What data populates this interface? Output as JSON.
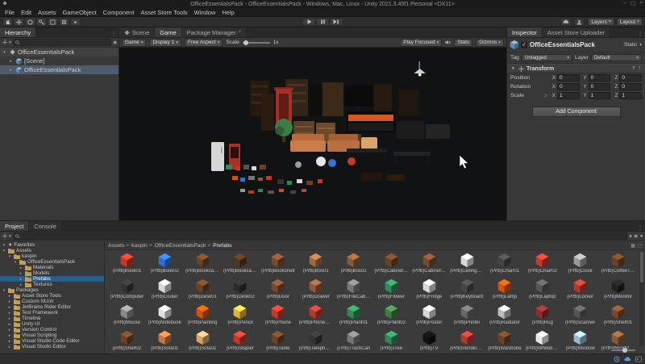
{
  "title_bar": {
    "title": "OfficeEssentialsPack - OfficeEssentialsPack - Windows, Mac, Linux - Unity 2021.3.45f1 Personal <DX11>",
    "minimize": "–",
    "maximize": "▢",
    "close": "×"
  },
  "menu_bar": {
    "items": [
      "File",
      "Edit",
      "Assets",
      "GameObject",
      "Component",
      "Asset Store Tools",
      "Window",
      "Help"
    ]
  },
  "toolbar": {
    "layers_label": "Layers",
    "layout_label": "Layout"
  },
  "hierarchy": {
    "tab": "Hierarchy",
    "items": [
      {
        "label": "OfficeEssentialsPack",
        "icon": "scene",
        "expanded": true,
        "depth": 0,
        "head": true
      },
      {
        "label": "[Scene]",
        "icon": "prefab",
        "expanded": false,
        "depth": 1
      },
      {
        "label": "OfficeEssentialsPack",
        "icon": "prefab",
        "expanded": false,
        "depth": 1,
        "selected": true
      }
    ]
  },
  "center": {
    "tabs": [
      {
        "label": "Scene",
        "active": false
      },
      {
        "label": "Game",
        "active": true
      },
      {
        "label": "Package Manager",
        "active": false,
        "closable": true
      }
    ],
    "close_glyph": "×"
  },
  "game_toolbar": {
    "display_target": "Game",
    "display": "Display 1",
    "aspect": "Free Aspect",
    "scale_label": "Scale",
    "scale_value": "1x",
    "play_focused": "Play Focused",
    "stats": "Stats",
    "gizmos": "Gizmos"
  },
  "inspector": {
    "tabs": [
      "Inspector",
      "Asset Store Uploader"
    ],
    "header": {
      "name": "OfficeEssentialsPack",
      "static_label": "Static",
      "check": "✓"
    },
    "tag_row": {
      "tag_label": "Tag",
      "tag_value": "Untagged",
      "layer_label": "Layer",
      "layer_value": "Default"
    },
    "transform": {
      "title": "Transform",
      "axis": [
        "X",
        "Y",
        "Z"
      ],
      "rows": [
        {
          "label": "Position",
          "x": "0",
          "y": "0",
          "z": "0"
        },
        {
          "label": "Rotation",
          "x": "0",
          "y": "0",
          "z": "0"
        },
        {
          "label": "Scale",
          "x": "1",
          "y": "1",
          "z": "1",
          "link": true
        }
      ]
    },
    "add_component": "Add Component"
  },
  "project": {
    "tabs": [
      "Project",
      "Console"
    ],
    "tree": [
      {
        "label": "Favorites",
        "icon": "star",
        "depth": 0,
        "expanded": true
      },
      {
        "label": "Assets",
        "icon": "folder",
        "depth": 0,
        "expanded": true
      },
      {
        "label": "kaspin",
        "icon": "folder",
        "depth": 1,
        "expanded": true
      },
      {
        "label": "OfficeEssentialsPack",
        "icon": "folder",
        "depth": 2,
        "expanded": true
      },
      {
        "label": "Materials",
        "icon": "folder",
        "depth": 3
      },
      {
        "label": "Models",
        "icon": "folder",
        "depth": 3
      },
      {
        "label": "Prefabs",
        "icon": "folder",
        "depth": 3,
        "selected": true
      },
      {
        "label": "Textures",
        "icon": "folder",
        "depth": 3
      },
      {
        "label": "Packages",
        "icon": "folder",
        "depth": 0,
        "expanded": true
      },
      {
        "label": "Asset Store Tools",
        "icon": "folder",
        "depth": 1
      },
      {
        "label": "Custom NUnit",
        "icon": "folder",
        "depth": 1
      },
      {
        "label": "JetBrains Rider Editor",
        "icon": "folder",
        "depth": 1
      },
      {
        "label": "Test Framework",
        "icon": "folder",
        "depth": 1
      },
      {
        "label": "Timeline",
        "icon": "folder",
        "depth": 1
      },
      {
        "label": "Unity UI",
        "icon": "folder",
        "depth": 1
      },
      {
        "label": "Version Control",
        "icon": "folder",
        "depth": 1
      },
      {
        "label": "Visual Scripting",
        "icon": "folder",
        "depth": 1
      },
      {
        "label": "Visual Studio Code Editor",
        "icon": "folder",
        "depth": 1
      },
      {
        "label": "Visual Studio Editor",
        "icon": "folder",
        "depth": 1
      }
    ],
    "breadcrumb": [
      "Assets",
      "kaspin",
      "OfficeEssentialsPack",
      "Prefabs"
    ],
    "grid": [
      {
        "label": "(Prfb)Book01",
        "color": "#c0392b"
      },
      {
        "label": "(Prfb)Book02",
        "color": "#2e6fd8"
      },
      {
        "label": "(Prfb)Bookcase01",
        "color": "#6b4226"
      },
      {
        "label": "(Prfb)Bookcase02",
        "color": "#553520"
      },
      {
        "label": "(Prfb)Bookshelf",
        "color": "#7a4a2e"
      },
      {
        "label": "(Prfb)Box01",
        "color": "#9c6b43"
      },
      {
        "label": "(Prfb)Box02",
        "color": "#8a5a3a"
      },
      {
        "label": "(Prfb)Cabinet01",
        "color": "#6b4226"
      },
      {
        "label": "(Prfb)Cabinet02",
        "color": "#7a4a2e"
      },
      {
        "label": "(Prfb)CeilingLamp",
        "color": "#d8d8d8"
      },
      {
        "label": "(Prfb)Chair01",
        "color": "#444444"
      },
      {
        "label": "(Prfb)Chair02",
        "color": "#c0392b"
      },
      {
        "label": "(Prfb)Clock",
        "color": "#999999"
      },
      {
        "label": "(Prfb)CoffeeTable",
        "color": "#6b4226"
      },
      {
        "label": "(Prfb)Computer",
        "color": "#333333"
      },
      {
        "label": "(Prfb)Cooler",
        "color": "#d8d8d8"
      },
      {
        "label": "(Prfb)Desk01",
        "color": "#6b4226"
      },
      {
        "label": "(Prfb)Desk02",
        "color": "#2b2b2b"
      },
      {
        "label": "(Prfb)Door",
        "color": "#7a4a2e"
      },
      {
        "label": "(Prfb)Drawer",
        "color": "#8a5a3a"
      },
      {
        "label": "(Prfb)FileCabinet",
        "color": "#777777"
      },
      {
        "label": "(Prfb)Flower",
        "color": "#2e8b57"
      },
      {
        "label": "(Prfb)Fridge",
        "color": "#d8d8d8"
      },
      {
        "label": "(Prfb)Keyboard",
        "color": "#444444"
      },
      {
        "label": "(Prfb)Lamp",
        "color": "#d35400"
      },
      {
        "label": "(Prfb)Laptop",
        "color": "#555555"
      },
      {
        "label": "(Prfb)Locker",
        "color": "#b03a30"
      },
      {
        "label": "(Prfb)Monitor",
        "color": "#222222"
      },
      {
        "label": "(Prfb)Mouse",
        "color": "#888888"
      },
      {
        "label": "(Prfb)Notebook",
        "color": "#e0e0e0"
      },
      {
        "label": "(Prfb)Painting",
        "color": "#d35400"
      },
      {
        "label": "(Prfb)Pencil",
        "color": "#e2b23a"
      },
      {
        "label": "(Prfb)Phone",
        "color": "#c0392b"
      },
      {
        "label": "(Prfb)PhoneBooth",
        "color": "#b03a30"
      },
      {
        "label": "(Prfb)Plant01",
        "color": "#2e8b57"
      },
      {
        "label": "(Prfb)Plant02",
        "color": "#3f7d45"
      },
      {
        "label": "(Prfb)Poster",
        "color": "#d8d8d8"
      },
      {
        "label": "(Prfb)Printer",
        "color": "#666666"
      },
      {
        "label": "(Prfb)Radiator",
        "color": "#bbbbbb"
      },
      {
        "label": "(Prfb)Rug",
        "color": "#8a2e2e"
      },
      {
        "label": "(Prfb)Scanner",
        "color": "#555555"
      },
      {
        "label": "(Prfb)Shelf01",
        "color": "#7a4a2e"
      },
      {
        "label": "(Prfb)Shelf02",
        "color": "#6b4226"
      },
      {
        "label": "(Prfb)Sofa01",
        "color": "#c97745"
      },
      {
        "label": "(Prfb)Sofa02",
        "color": "#d9a36a"
      },
      {
        "label": "(Prfb)Stapler",
        "color": "#c0392b"
      },
      {
        "label": "(Prfb)Table",
        "color": "#6b4226"
      },
      {
        "label": "(Prfb)Telephone",
        "color": "#333333"
      },
      {
        "label": "(Prfb)TrashCan",
        "color": "#777777"
      },
      {
        "label": "(Prfb)Tree",
        "color": "#2e8b57"
      },
      {
        "label": "(Prfb)TV",
        "color": "#111111"
      },
      {
        "label": "(Prfb)VendingMachine",
        "color": "#b03a30"
      },
      {
        "label": "(Prfb)Wardrobe",
        "color": "#6b4226"
      },
      {
        "label": "(Prfb)Whiteboard",
        "color": "#e8e8e8"
      },
      {
        "label": "(Prfb)Window",
        "color": "#9ab6c9"
      },
      {
        "label": "(Prfb)WoodPanel",
        "color": "#8a5a3a"
      }
    ]
  },
  "colors": {
    "accent": "#2d5c87",
    "selection_gray": "#4c5b6d",
    "orange_board": "#d4591f"
  }
}
